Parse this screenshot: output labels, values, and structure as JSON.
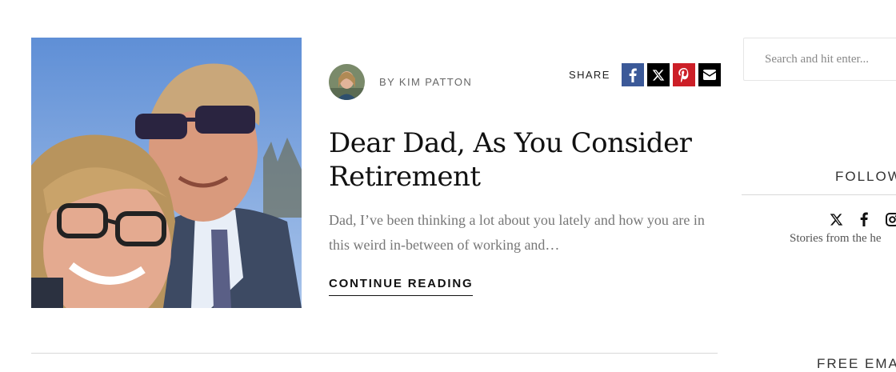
{
  "article": {
    "image_alt": "woman and man in sunglasses smiling",
    "byline": "BY KIM PATTON",
    "share_label": "SHARE",
    "title": "Dear Dad, As You Consider Retirement",
    "excerpt": "Dad, I’ve been thinking a lot about you lately and how you are in this weird in-between of working and…",
    "continue_label": "CONTINUE READING",
    "share_buttons": [
      {
        "icon": "facebook-icon",
        "color": "#3b5998"
      },
      {
        "icon": "x-icon",
        "color": "#000000"
      },
      {
        "icon": "pinterest-icon",
        "color": "#cc1f27"
      },
      {
        "icon": "email-icon",
        "color": "#000000"
      }
    ]
  },
  "sidebar": {
    "search_placeholder": "Search and hit enter...",
    "follow_heading": "FOLLOW",
    "follow_icons": [
      "x-icon",
      "facebook-icon",
      "instagram-icon"
    ],
    "tagline": "Stories from the he",
    "email_heading": "FREE EMAI"
  }
}
